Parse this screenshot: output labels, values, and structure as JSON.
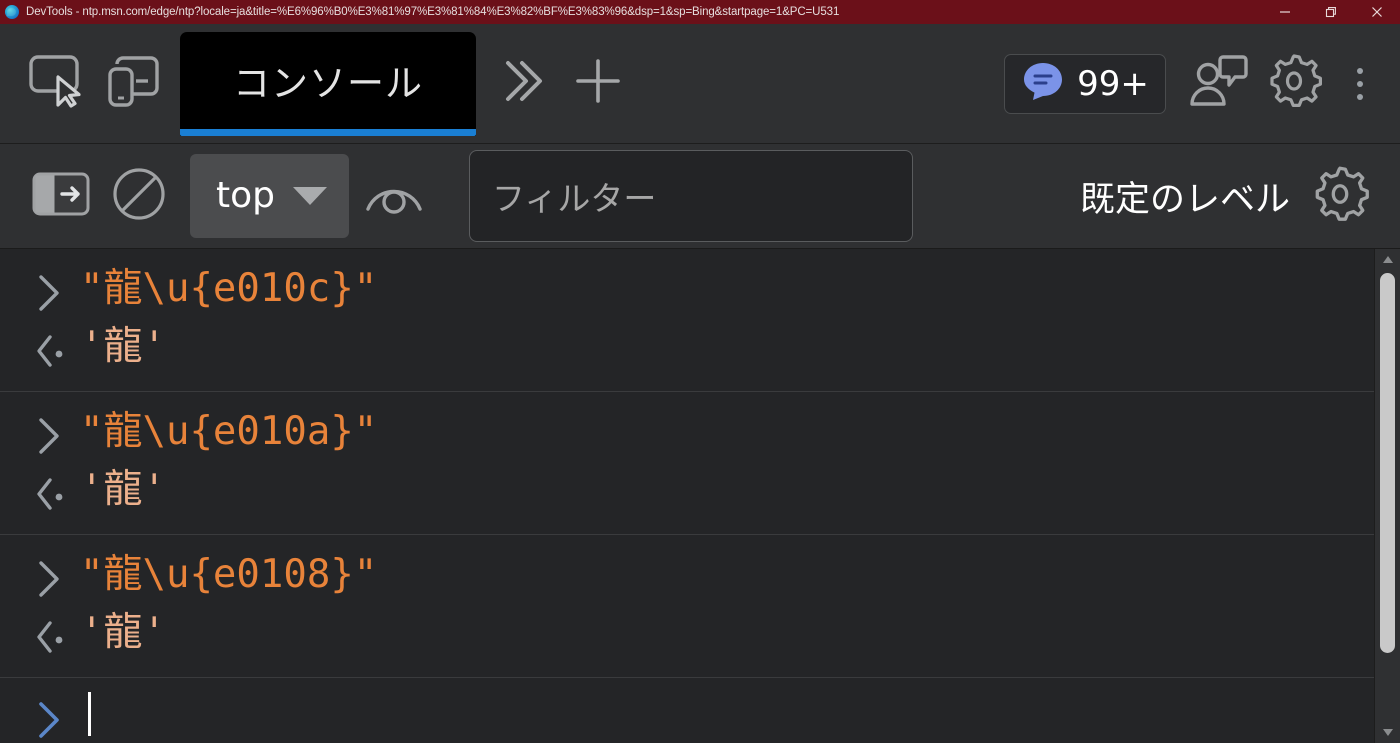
{
  "window": {
    "title": "DevTools - ntp.msn.com/edge/ntp?locale=ja&title=%E6%96%B0%E3%81%97%E3%81%84%E3%82%BF%E3%83%96&dsp=1&sp=Bing&startpage=1&PC=U531",
    "logo_icon": "edge-logo-icon",
    "controls": {
      "minimize": "minimize-icon",
      "restore": "restore-icon",
      "close": "close-icon"
    },
    "titlebar_color": "#6b1019"
  },
  "tabbar": {
    "inspect_icon": "inspect-element-icon",
    "device_icon": "device-toolbar-icon",
    "active_tab": "コンソール",
    "more_tabs_icon": "chevron-double-right-icon",
    "add_tab_icon": "plus-icon",
    "messages_badge": {
      "icon": "message-bubble-icon",
      "count": "99+",
      "accent": "#7b93e8"
    },
    "feedback_icon": "feedback-person-icon",
    "settings_icon": "gear-icon",
    "more_options_icon": "kebab-menu-icon",
    "active_underline_color": "#1a7fd4"
  },
  "console_toolbar": {
    "sidebar_toggle_icon": "console-sidebar-toggle-icon",
    "clear_icon": "clear-console-icon",
    "context_selector": {
      "value": "top",
      "caret_icon": "chevron-down-icon"
    },
    "live_expression_icon": "eye-icon",
    "filter": {
      "value": "",
      "placeholder": "フィルター"
    },
    "levels_label": "既定のレベル",
    "settings_icon": "gear-icon"
  },
  "console": {
    "prompt_icon": "chevron-right-icon",
    "result_icon": "chevron-left-dot-icon",
    "entries": [
      {
        "command": "\"龍\\u{e010c}\"",
        "result": "'龍'"
      },
      {
        "command": "\"龍\\u{e010a}\"",
        "result": "'龍'"
      },
      {
        "command": "\"龍\\u{e0108}\"",
        "result": "'龍'"
      }
    ],
    "active_prompt": {
      "icon": "chevron-right-active-icon",
      "value": "",
      "caret": "|"
    },
    "command_color": "#e8833a",
    "result_color": "#ecb08c"
  },
  "scrollbar": {
    "up_icon": "scroll-up-arrow-icon",
    "down_icon": "scroll-down-arrow-icon",
    "thumb": "scrollbar-thumb"
  }
}
